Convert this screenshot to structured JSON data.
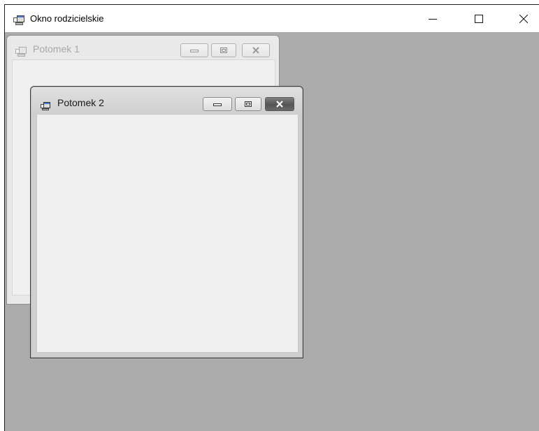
{
  "parent_window": {
    "title": "Okno rodzicielskie",
    "controls": {
      "minimize": "—",
      "maximize": "☐",
      "close": "✕"
    }
  },
  "children": [
    {
      "title": "Potomek 1",
      "state": "inactive"
    },
    {
      "title": "Potomek 2",
      "state": "active"
    }
  ],
  "icons": {
    "window_icon": "app-window-icon",
    "minimize": "minimize-icon",
    "maximize": "maximize-icon",
    "close": "close-icon"
  },
  "colors": {
    "mdi_background": "#ababab",
    "child_client": "#efefef",
    "titlebar": "#ffffff"
  }
}
